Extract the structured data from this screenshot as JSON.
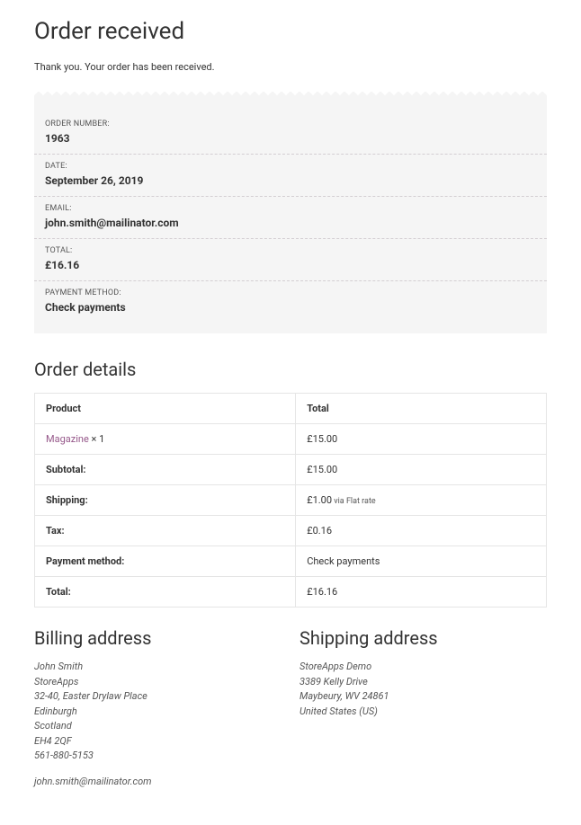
{
  "page": {
    "title": "Order received",
    "thankyou": "Thank you. Your order has been received."
  },
  "overview": {
    "order_number_label": "ORDER NUMBER:",
    "order_number": "1963",
    "date_label": "DATE:",
    "date": "September 26, 2019",
    "email_label": "EMAIL:",
    "email": "john.smith@mailinator.com",
    "total_label": "TOTAL:",
    "total": "£16.16",
    "payment_method_label": "PAYMENT METHOD:",
    "payment_method": "Check payments"
  },
  "order_details": {
    "heading": "Order details",
    "th_product": "Product",
    "th_total": "Total",
    "item": {
      "name": "Magazine",
      "qty": " × 1",
      "total": "£15.00"
    },
    "subtotal_label": "Subtotal:",
    "subtotal": "£15.00",
    "shipping_label": "Shipping:",
    "shipping_amount": "£1.00",
    "shipping_method": " via Flat rate",
    "tax_label": "Tax:",
    "tax": "£0.16",
    "payment_method_label": "Payment method:",
    "payment_method": "Check payments",
    "total_label": "Total:",
    "total": "£16.16"
  },
  "billing": {
    "heading": "Billing address",
    "name": "John Smith",
    "company": "StoreApps",
    "street": "32-40, Easter Drylaw Place",
    "city": "Edinburgh",
    "region": "Scotland",
    "postcode": "EH4 2QF",
    "phone": "561-880-5153",
    "email": "john.smith@mailinator.com"
  },
  "shipping": {
    "heading": "Shipping address",
    "name": "StoreApps Demo",
    "street": "3389 Kelly Drive",
    "city_state_zip": "Maybeury, WV 24861",
    "country": "United States (US)"
  }
}
